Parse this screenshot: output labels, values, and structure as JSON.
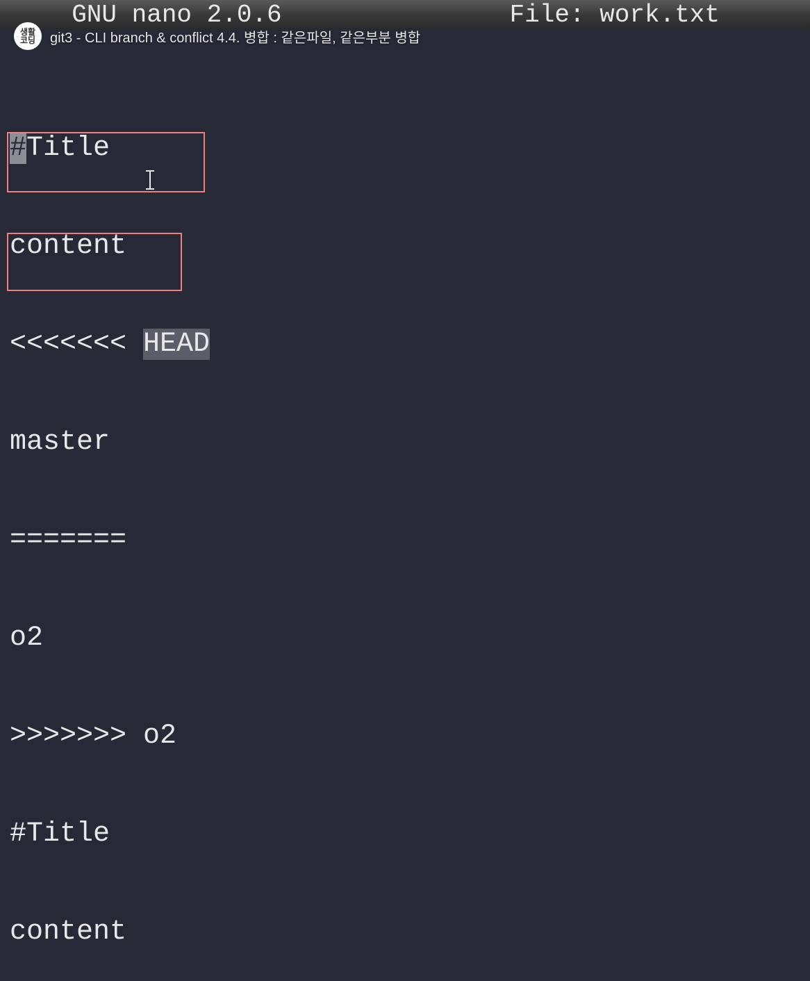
{
  "titlebar": {
    "app_version": "  GNU nano 2.0.6",
    "file_label": "File: work.txt"
  },
  "overlay": {
    "avatar_top": "생활",
    "avatar_bottom": "코딩",
    "video_title": "git3 - CLI branch & conflict 4.4. 병합 : 같은파일, 같은부분 병합"
  },
  "editor_lines": {
    "l1_prefix": "#",
    "l1_rest": "Title",
    "l2": "content",
    "l3_prefix": "<<<<<<< ",
    "l3_head": "HEAD",
    "l4": "master",
    "l5": "=======",
    "l6": "o2",
    "l7": ">>>>>>> o2",
    "l8": "#Title",
    "l9": "content"
  }
}
